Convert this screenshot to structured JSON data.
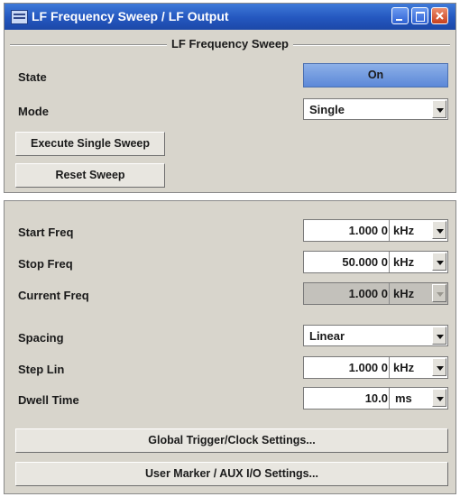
{
  "window": {
    "title": "LF Frequency Sweep / LF Output"
  },
  "group": {
    "title": "LF Frequency Sweep"
  },
  "state": {
    "label": "State",
    "value": "On"
  },
  "mode": {
    "label": "Mode",
    "value": "Single"
  },
  "buttons": {
    "execute": "Execute Single Sweep",
    "reset": "Reset Sweep",
    "global_trigger": "Global Trigger/Clock Settings...",
    "user_marker": "User Marker / AUX I/O Settings..."
  },
  "start_freq": {
    "label": "Start Freq",
    "value": "1.000 0",
    "unit": "kHz"
  },
  "stop_freq": {
    "label": "Stop Freq",
    "value": "50.000 0",
    "unit": "kHz"
  },
  "current_freq": {
    "label": "Current Freq",
    "value": "1.000 0",
    "unit": "kHz"
  },
  "spacing": {
    "label": "Spacing",
    "value": "Linear"
  },
  "step_lin": {
    "label": "Step Lin",
    "value": "1.000 0",
    "unit": "kHz"
  },
  "dwell_time": {
    "label": "Dwell Time",
    "value": "10.0",
    "unit": "ms"
  }
}
